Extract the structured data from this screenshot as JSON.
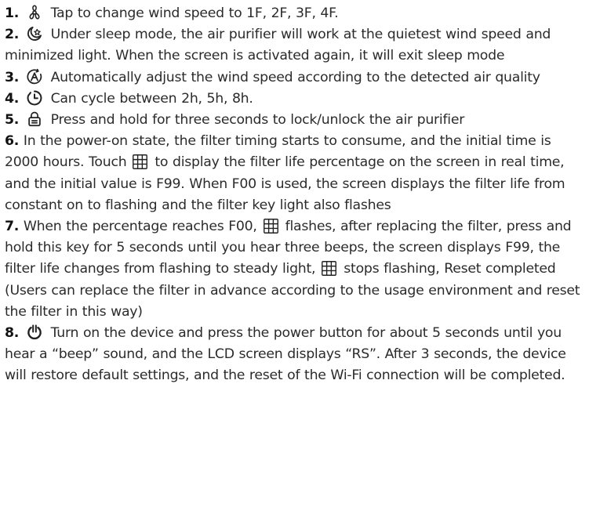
{
  "items": [
    {
      "num": "1.",
      "icon": "fan-icon",
      "text": "Tap to change wind speed to 1F, 2F, 3F, 4F."
    },
    {
      "num": "2.",
      "icon": "sleep-mode-icon",
      "text": "Under sleep mode, the air purifier will work at the quietest wind speed and minimized light. When the screen is activated again, it will exit sleep mode"
    },
    {
      "num": "3.",
      "icon": "auto-mode-icon",
      "text": "Automatically adjust the wind speed according to the detected air quality"
    },
    {
      "num": "4.",
      "icon": "timer-icon",
      "text": "Can cycle between 2h, 5h, 8h."
    },
    {
      "num": "5.",
      "icon": "lock-icon",
      "text": "Press and hold for three seconds to lock/unlock the air purifier"
    },
    {
      "num": "6.",
      "text_a": "In the power-on state, the filter timing starts to consume, and the initial time is 2000 hours. Touch",
      "text_b": "to display the filter life percentage on the screen in real time, and the initial value is F99. When F00 is used, the screen displays the filter life from constant on to flashing and the filter key light also flashes"
    },
    {
      "num": "7.",
      "text_a": "When the percentage reaches F00,",
      "text_b": "flashes, after replacing the filter, press and hold this key for 5 seconds until you hear three beeps, the screen displays F99, the filter life changes from flashing to steady light,",
      "text_c": "stops flashing, Reset completed (Users can replace the filter in advance according to the usage environment and reset the filter in this way)"
    },
    {
      "num": "8.",
      "icon": "power-icon",
      "text": "Turn on the device and press the power button for about 5 seconds until you hear a “beep” sound, and the LCD screen  displays “RS”. After 3 seconds, the device will restore default settings, and the reset of the Wi-Fi connection will be completed."
    }
  ]
}
